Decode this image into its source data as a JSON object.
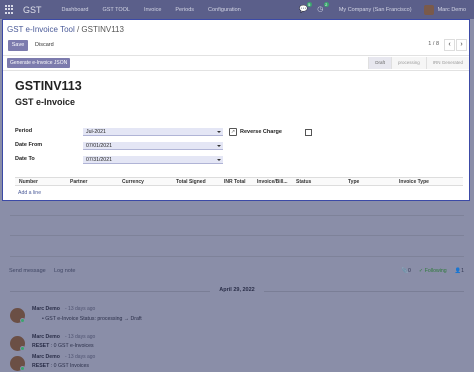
{
  "navbar": {
    "brand": "GST",
    "menu": [
      "Dashboard",
      "GST TOOL",
      "Invoice",
      "Periods",
      "Configuration"
    ],
    "chat_badge": "5",
    "activity_badge": "2",
    "company": "My Company (San Francisco)",
    "user": "Marc Demo"
  },
  "breadcrumb": {
    "parent": "GST e-Invoice Tool",
    "separator": " / ",
    "current": "GSTINV113"
  },
  "toolbar": {
    "save_label": "Save",
    "discard_label": "Discard",
    "pager": "1 / 8",
    "prev": "‹",
    "next": "›"
  },
  "statusbar": {
    "action_label": "Generate e-Invoice JSON",
    "steps": [
      "Draft",
      "processing",
      "IRN Generated"
    ],
    "active_step": "Draft"
  },
  "form": {
    "name": "GSTINV113",
    "subtitle": "GST e-Invoice",
    "period_label": "Period",
    "period_value": "Jul-2021",
    "date_from_label": "Date From",
    "date_from_value": "07/01/2021",
    "date_to_label": "Date To",
    "date_to_value": "07/31/2021",
    "reverse_charge_label": "Reverse Charge",
    "reverse_charge_checked": false
  },
  "grid": {
    "columns": [
      "Number",
      "Partner",
      "Currency",
      "Total Signed",
      "INR Total",
      "Invoice/Bill...",
      "Status",
      "Type",
      "Invoice Type"
    ],
    "add_line": "Add a line"
  },
  "chatter": {
    "send_message": "Send message",
    "log_note": "Log note",
    "attachments_count": "0",
    "following_label": "Following",
    "followers_count": "1",
    "date_separator": "April 29, 2022",
    "messages": [
      {
        "author": "Marc Demo",
        "time": "- 13 days ago",
        "bullet": "GST e-Invoice Status: processing → Draft"
      },
      {
        "author": "Marc Demo",
        "time": "- 13 days ago",
        "bold": "RESET",
        "text": " : 0 GST e-Invoices"
      },
      {
        "author": "Marc Demo",
        "time": "- 13 days ago",
        "bold": "RESET",
        "text": " : 0 GST Invoices"
      }
    ]
  }
}
